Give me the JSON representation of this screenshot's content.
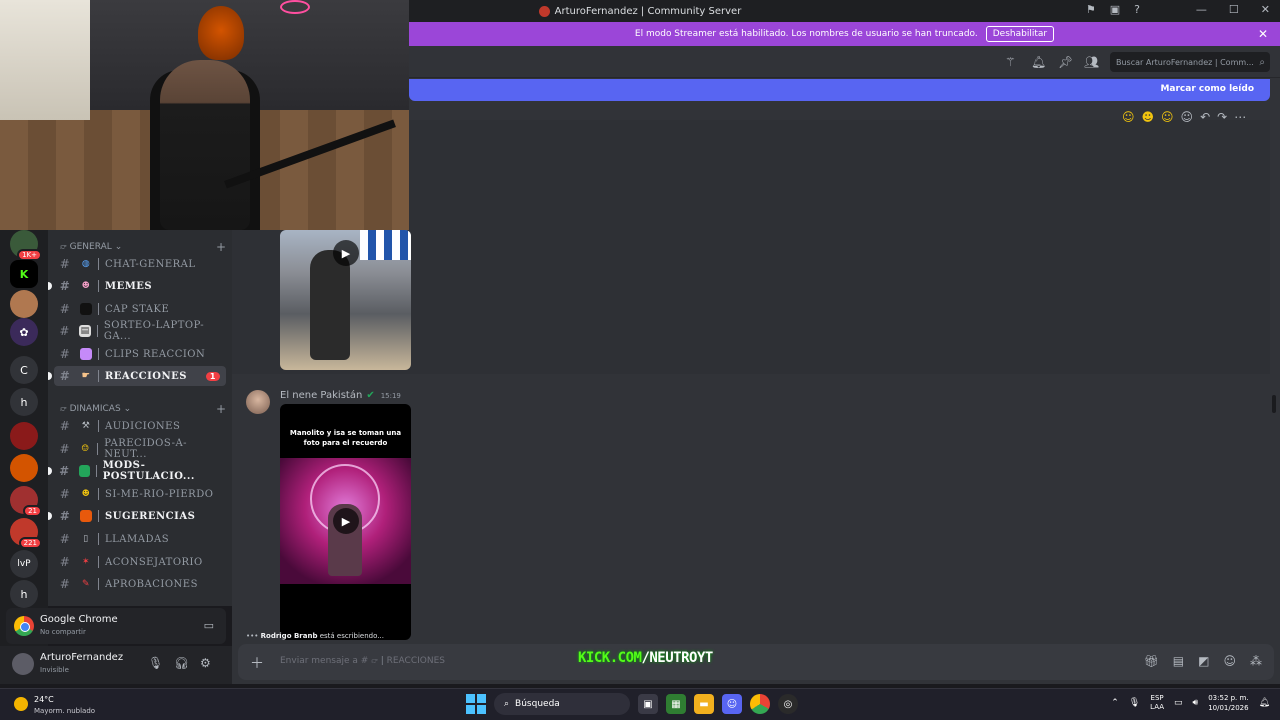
{
  "window": {
    "title": "ArturoFernandez | Community Server"
  },
  "banner": {
    "text": "El modo Streamer está habilitado. Los nombres de usuario se han truncado.",
    "button_label": "Deshabilitar"
  },
  "toolbar": {
    "search_placeholder": "Buscar ArturoFernandez | Comm..."
  },
  "read_bar": {
    "label": "Marcar como leído"
  },
  "server_rail": {
    "badges": [
      "1K+",
      "21",
      "221"
    ],
    "letters": [
      "C",
      "h",
      "lvP",
      "h"
    ]
  },
  "categories": [
    {
      "label": "GENERAL"
    },
    {
      "label": "DINAMICAS"
    }
  ],
  "channels": [
    {
      "name": "CHAT-GENERAL",
      "bold": false,
      "color": "#5aa7ff"
    },
    {
      "name": "MEMES",
      "bold": true,
      "color": "#f5a0c8"
    },
    {
      "name": "CAP STAKE",
      "bold": false,
      "color": "#111111"
    },
    {
      "name": "SORTEO-LAPTOP-GA...",
      "bold": false,
      "color": "#dddddd"
    },
    {
      "name": "CLIPS REACCION",
      "bold": false,
      "color": "#c58af9"
    },
    {
      "name": "REACCIONES",
      "bold": true,
      "active": true,
      "color": "#f5c28a",
      "count": "1"
    },
    {
      "name": "AUDICIONES",
      "bold": false,
      "color": "#b5bac1"
    },
    {
      "name": "PARECIDOS-A-NEUT...",
      "bold": false,
      "color": "#f1c40f"
    },
    {
      "name": "MODS-POSTULACIO...",
      "bold": true,
      "color": "#23a55a"
    },
    {
      "name": "SI-ME-RIO-PIERDO",
      "bold": false,
      "color": "#f1c40f"
    },
    {
      "name": "SUGERENCIAS",
      "bold": true,
      "color": "#e8590c"
    },
    {
      "name": "LLAMADAS",
      "bold": false,
      "color": "#b5bac1"
    },
    {
      "name": "ACONSEJATORIO",
      "bold": false,
      "color": "#f23f43"
    },
    {
      "name": "APROBACIONES",
      "bold": false,
      "color": "#f23f43"
    }
  ],
  "voice": {
    "app": "Google Chrome",
    "status": "No compartir"
  },
  "user": {
    "name": "ArturoFernandez",
    "status": "Invisible"
  },
  "message": {
    "author": "El nene Pakistán",
    "time": "15:19",
    "video_caption": "Manolito y isa se toman una foto para el recuerdo"
  },
  "typing": {
    "user": "Rodrigo Branb",
    "suffix": "está escribiendo..."
  },
  "composer": {
    "placeholder": "Enviar mensaje a #",
    "channel": "REACCIONES"
  },
  "overlay": {
    "kick_green": "KICK.COM",
    "kick_white": "/NEUTROYT"
  },
  "taskbar": {
    "temp": "24°C",
    "condition": "Mayorm. nublado",
    "search": "Búsqueda",
    "lang_top": "ESP",
    "lang_bottom": "LAA",
    "time": "03:52 p. m.",
    "date": "10/01/2026"
  }
}
